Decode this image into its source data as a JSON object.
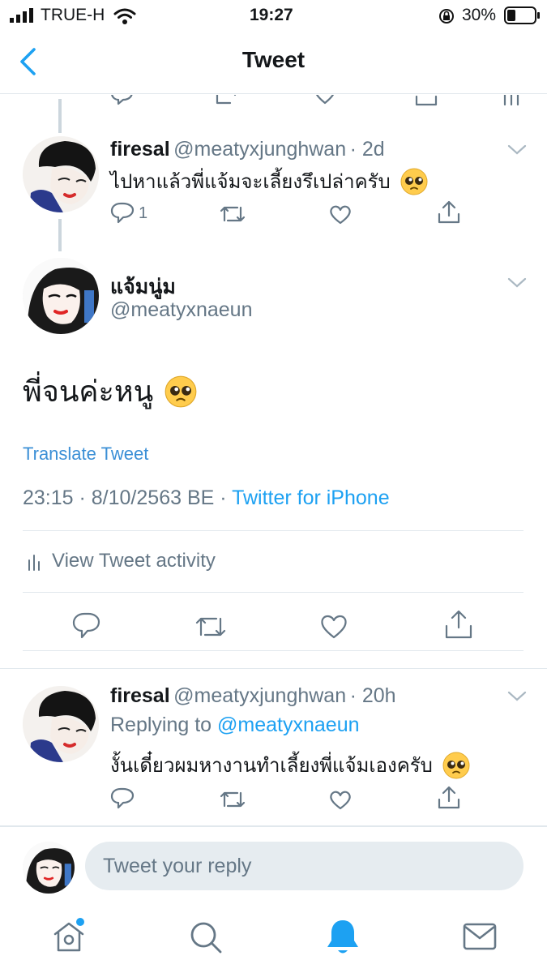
{
  "status_bar": {
    "carrier": "TRUE-H",
    "time": "19:27",
    "battery": "30%"
  },
  "nav": {
    "title": "Tweet"
  },
  "tweet_prev": {
    "name": "firesal",
    "handle": "@meatyxjunghwan",
    "time": "· 2d",
    "text": "ไปหาแล้วพี่แจ้มจะเลี้ยงรึเปล่าครับ",
    "reply_count": "1"
  },
  "main_tweet": {
    "name": "แจ้มนู่ม",
    "handle": "@meatyxnaeun",
    "text": "พี่จนค่ะหนู",
    "translate": "Translate Tweet",
    "timestamp": "23:15 · 8/10/2563 BE · ",
    "source": "Twitter for iPhone",
    "activity": "View Tweet activity"
  },
  "reply_tweet": {
    "name": "firesal",
    "handle": "@meatyxjunghwan",
    "time": "· 20h",
    "replying_prefix": "Replying to ",
    "replying_to": "@meatyxnaeun",
    "text": "งั้นเดี๋ยวผมหางานทำเลี้ยงพี่แจ้มเองครับ"
  },
  "composer": {
    "placeholder": "Tweet your reply"
  },
  "colors": {
    "accent": "#1da1f2",
    "text": "#14171a",
    "muted": "#657786",
    "divider": "#e1e8ed"
  },
  "icons": [
    "signal-icon",
    "wifi-icon",
    "orientation-lock-icon",
    "battery-icon",
    "back-chevron-icon",
    "reply-icon",
    "retweet-icon",
    "like-icon",
    "share-icon",
    "analytics-icon",
    "caret-down-icon",
    "pleading-emoji-icon",
    "home-icon",
    "search-icon",
    "notifications-icon",
    "messages-icon"
  ]
}
